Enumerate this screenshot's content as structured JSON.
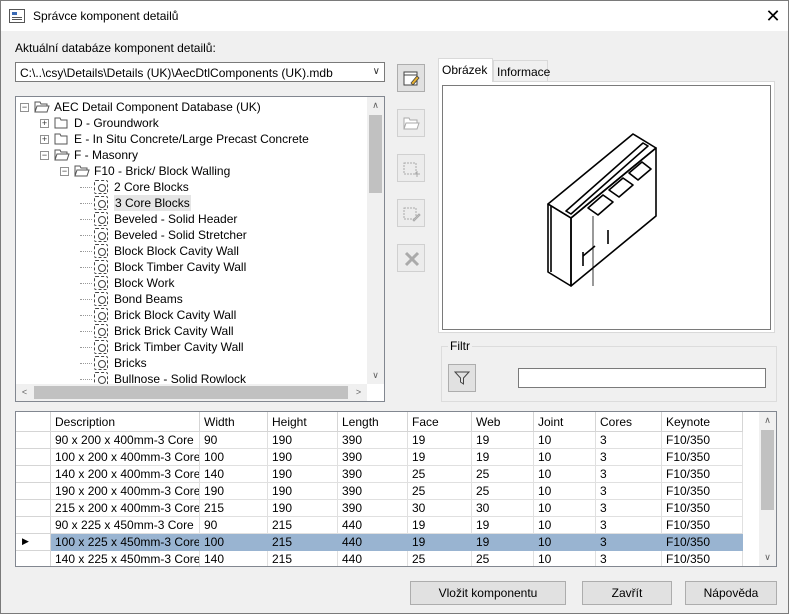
{
  "window": {
    "title": "Správce komponent detailů"
  },
  "database": {
    "label": "Aktuální databáze komponent detailů:",
    "path": "C:\\..\\csy\\Details\\Details (UK)\\AecDtlComponents (UK).mdb"
  },
  "tree": {
    "items": [
      {
        "label": "AEC Detail Component Database (UK)",
        "level": 0,
        "kind": "folder",
        "state": "expanded"
      },
      {
        "label": "D - Groundwork",
        "level": 1,
        "kind": "folder",
        "state": "collapsed"
      },
      {
        "label": "E - In Situ Concrete/Large Precast Concrete",
        "level": 1,
        "kind": "folder",
        "state": "collapsed"
      },
      {
        "label": "F - Masonry",
        "level": 1,
        "kind": "folder",
        "state": "expanded"
      },
      {
        "label": "F10 - Brick/ Block Walling",
        "level": 2,
        "kind": "folder",
        "state": "expanded"
      },
      {
        "label": "2 Core Blocks",
        "level": 3,
        "kind": "item"
      },
      {
        "label": "3 Core Blocks",
        "level": 3,
        "kind": "item",
        "selected": true
      },
      {
        "label": "Beveled - Solid Header",
        "level": 3,
        "kind": "item"
      },
      {
        "label": "Beveled - Solid Stretcher",
        "level": 3,
        "kind": "item"
      },
      {
        "label": "Block Block Cavity Wall",
        "level": 3,
        "kind": "item"
      },
      {
        "label": "Block Timber Cavity Wall",
        "level": 3,
        "kind": "item"
      },
      {
        "label": "Block Work",
        "level": 3,
        "kind": "item"
      },
      {
        "label": "Bond Beams",
        "level": 3,
        "kind": "item"
      },
      {
        "label": "Brick Block Cavity Wall",
        "level": 3,
        "kind": "item"
      },
      {
        "label": "Brick Brick Cavity Wall",
        "level": 3,
        "kind": "item"
      },
      {
        "label": "Brick Timber Cavity Wall",
        "level": 3,
        "kind": "item"
      },
      {
        "label": "Bricks",
        "level": 3,
        "kind": "item"
      },
      {
        "label": "Bullnose - Solid Rowlock",
        "level": 3,
        "kind": "item"
      }
    ]
  },
  "toolbar": {
    "buttons": [
      {
        "name": "edit-database-button",
        "icon": "edit-database-icon",
        "enabled": true
      },
      {
        "name": "open-folder-button",
        "icon": "folder-icon",
        "enabled": false
      },
      {
        "name": "add-component-button",
        "icon": "add-icon",
        "enabled": false
      },
      {
        "name": "edit-component-button",
        "icon": "edit-icon",
        "enabled": false
      },
      {
        "name": "delete-button",
        "icon": "delete-icon",
        "enabled": false
      }
    ]
  },
  "preview": {
    "tabs": [
      {
        "label": "Obrázek",
        "active": true
      },
      {
        "label": "Informace",
        "active": false
      }
    ]
  },
  "filter": {
    "label": "Filtr",
    "value": ""
  },
  "table": {
    "columns": [
      "Description",
      "Width",
      "Height",
      "Length",
      "Face",
      "Web",
      "Joint",
      "Cores",
      "Keynote"
    ],
    "rows": [
      [
        "90 x 200 x 400mm-3 Core",
        "90",
        "190",
        "390",
        "19",
        "19",
        "10",
        "3",
        "F10/350"
      ],
      [
        "100 x 200 x 400mm-3 Core",
        "100",
        "190",
        "390",
        "19",
        "19",
        "10",
        "3",
        "F10/350"
      ],
      [
        "140 x 200 x 400mm-3 Core",
        "140",
        "190",
        "390",
        "25",
        "25",
        "10",
        "3",
        "F10/350"
      ],
      [
        "190 x 200 x 400mm-3 Core",
        "190",
        "190",
        "390",
        "25",
        "25",
        "10",
        "3",
        "F10/350"
      ],
      [
        "215 x 200 x 400mm-3 Core",
        "215",
        "190",
        "390",
        "30",
        "30",
        "10",
        "3",
        "F10/350"
      ],
      [
        "90 x 225 x 450mm-3 Core",
        "90",
        "215",
        "440",
        "19",
        "19",
        "10",
        "3",
        "F10/350"
      ],
      [
        "100 x 225 x 450mm-3 Core",
        "100",
        "215",
        "440",
        "19",
        "19",
        "10",
        "3",
        "F10/350"
      ],
      [
        "140 x 225 x 450mm-3 Core",
        "140",
        "215",
        "440",
        "25",
        "25",
        "10",
        "3",
        "F10/350"
      ]
    ],
    "selected_row": 6
  },
  "buttons": {
    "insert": "Vložit komponentu",
    "close": "Zavřít",
    "help": "Nápověda"
  },
  "colors": {
    "selection": "#99b4d1",
    "window_bg": "#f0f0f0"
  }
}
